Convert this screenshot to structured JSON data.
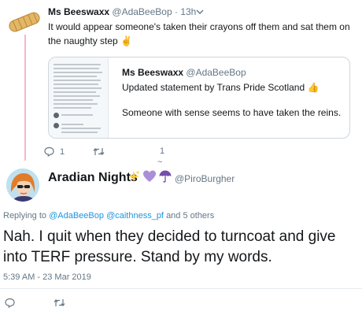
{
  "tweet1": {
    "author_name": "Ms Beeswaxx",
    "author_handle": "@AdaBeeBop",
    "separator": "·",
    "time": "13h",
    "text": "It would appear someone's taken their crayons off them and sat them on the naughty step",
    "emoji": "✌"
  },
  "quoted_tweet": {
    "author_name": "Ms Beeswaxx",
    "author_handle": "@AdaBeeBop",
    "line1": "Updated statement by Trans Pride Scotland",
    "line1_emoji": "👍",
    "line2": "Someone with sense seems to have taken the reins."
  },
  "tweet1_actions": {
    "reply_count": "1",
    "retweet_count": "",
    "like_count": "1"
  },
  "tweet2": {
    "author_name": "Aradian Nights",
    "author_handle": "@PiroBurgher",
    "replying_label": "Replying to",
    "mention1": "@AdaBeeBop",
    "mention2": "@caithness_pf",
    "others": "and 5 others",
    "text": "Nah. I quit when they decided to turncoat and give into TERF pressure. Stand by my words.",
    "timestamp": "5:39 AM - 23 Mar 2019"
  },
  "colors": {
    "thread_line": "#f4b8c6",
    "link": "#1b95e0",
    "secondary_text": "#657786"
  }
}
